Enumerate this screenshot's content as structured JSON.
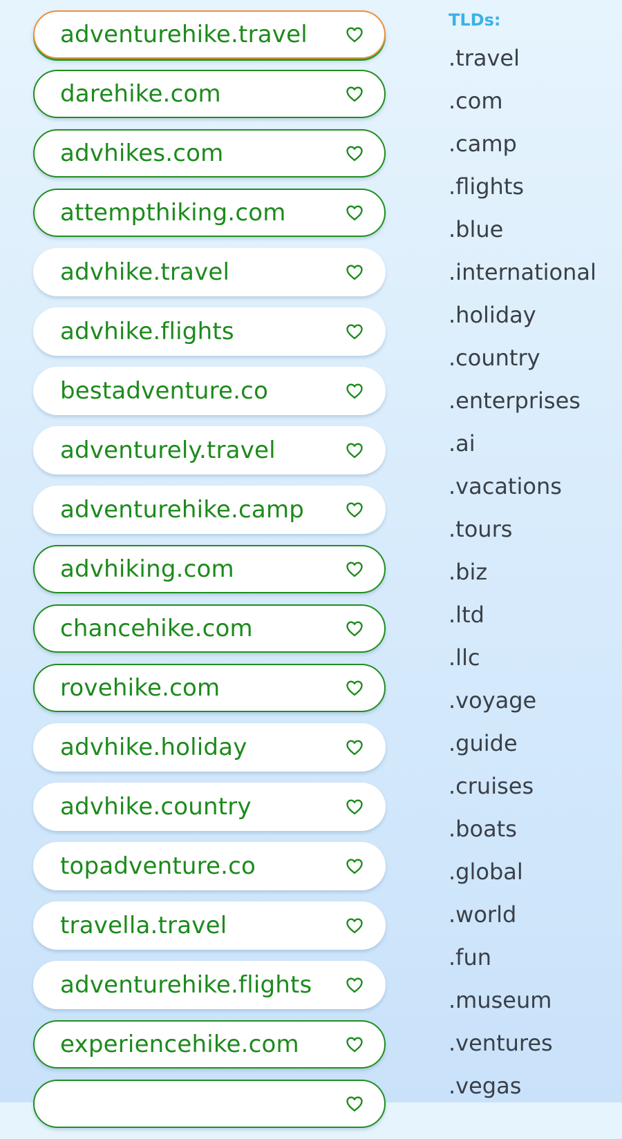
{
  "domains": [
    {
      "label": "adventurehike.travel",
      "state": "focused"
    },
    {
      "label": "darehike.com",
      "state": "outlined"
    },
    {
      "label": "advhikes.com",
      "state": "outlined"
    },
    {
      "label": "attempthiking.com",
      "state": "outlined"
    },
    {
      "label": "advhike.travel",
      "state": "plain"
    },
    {
      "label": "advhike.flights",
      "state": "plain"
    },
    {
      "label": "bestadventure.co",
      "state": "plain"
    },
    {
      "label": "adventurely.travel",
      "state": "plain"
    },
    {
      "label": "adventurehike.camp",
      "state": "plain"
    },
    {
      "label": "advhiking.com",
      "state": "outlined"
    },
    {
      "label": "chancehike.com",
      "state": "outlined"
    },
    {
      "label": "rovehike.com",
      "state": "outlined"
    },
    {
      "label": "advhike.holiday",
      "state": "plain"
    },
    {
      "label": "advhike.country",
      "state": "plain"
    },
    {
      "label": "topadventure.co",
      "state": "plain"
    },
    {
      "label": "travella.travel",
      "state": "plain"
    },
    {
      "label": "adventurehike.flights",
      "state": "plain"
    },
    {
      "label": "experiencehike.com",
      "state": "outlined"
    },
    {
      "label": "",
      "state": "outlined"
    }
  ],
  "heart_icon": "heart-outline-icon",
  "tlds": {
    "heading": "TLDs:",
    "items": [
      ".travel",
      ".com",
      ".camp",
      ".flights",
      ".blue",
      ".international",
      ".holiday",
      ".country",
      ".enterprises",
      ".ai",
      ".vacations",
      ".tours",
      ".biz",
      ".ltd",
      ".llc",
      ".voyage",
      ".guide",
      ".cruises",
      ".boats",
      ".global",
      ".world",
      ".fun",
      ".museum",
      ".ventures",
      ".vegas"
    ]
  },
  "colors": {
    "domain_text": "#1c8a1c",
    "outline": "#1f8f1f",
    "focus_ring": "#e8913c",
    "tld_heading": "#3bb2e8",
    "tld_text": "#3a3f47",
    "background_top": "#e6f4fd",
    "background_bottom": "#c9e2fa"
  }
}
